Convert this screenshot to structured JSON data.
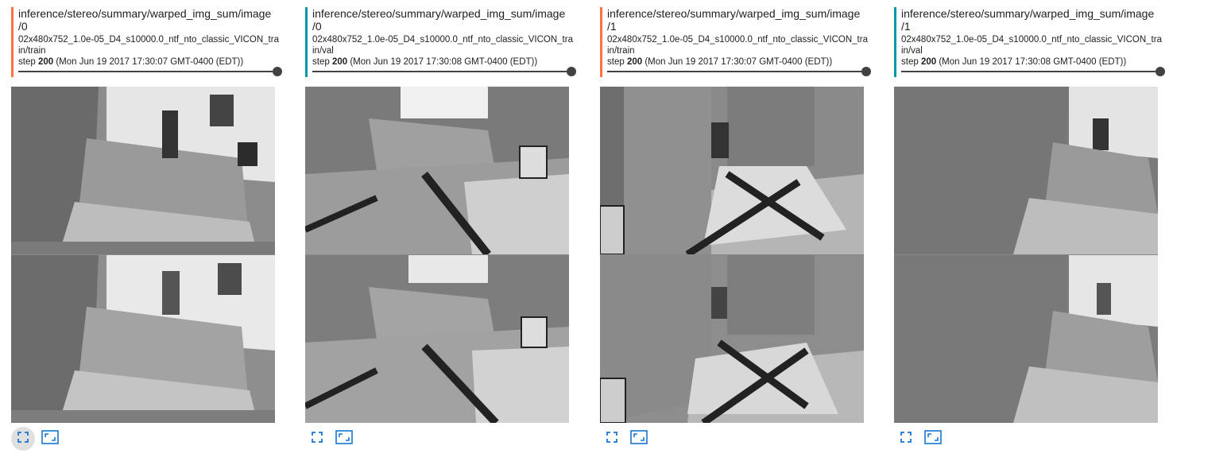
{
  "accent_colors": {
    "train": "#ff7043",
    "val": "#0097a7",
    "icon": "#1976d2"
  },
  "cards": [
    {
      "tag": "inference/stereo/summary/warped_img_sum/image/0",
      "run": "02x480x752_1.0e-05_D4_s10000.0_ntf_nto_classic_VICON_train/train",
      "step_prefix": "step",
      "step_value": "200",
      "timestamp": "(Mon Jun 19 2017 17:30:07 GMT-0400 (EDT))",
      "split": "train",
      "step_progress": 1.0,
      "actions": [
        "fit-to-screen-icon",
        "full-screen-icon"
      ]
    },
    {
      "tag": "inference/stereo/summary/warped_img_sum/image/0",
      "run": "02x480x752_1.0e-05_D4_s10000.0_ntf_nto_classic_VICON_train/val",
      "step_prefix": "step",
      "step_value": "200",
      "timestamp": "(Mon Jun 19 2017 17:30:08 GMT-0400 (EDT))",
      "split": "val",
      "step_progress": 1.0,
      "actions": [
        "fit-to-screen-icon",
        "full-screen-icon"
      ]
    },
    {
      "tag": "inference/stereo/summary/warped_img_sum/image/1",
      "run": "02x480x752_1.0e-05_D4_s10000.0_ntf_nto_classic_VICON_train/train",
      "step_prefix": "step",
      "step_value": "200",
      "timestamp": "(Mon Jun 19 2017 17:30:07 GMT-0400 (EDT))",
      "split": "train",
      "step_progress": 1.0,
      "actions": [
        "fit-to-screen-icon",
        "full-screen-icon"
      ]
    },
    {
      "tag": "inference/stereo/summary/warped_img_sum/image/1",
      "run": "02x480x752_1.0e-05_D4_s10000.0_ntf_nto_classic_VICON_train/val",
      "step_prefix": "step",
      "step_value": "200",
      "timestamp": "(Mon Jun 19 2017 17:30:08 GMT-0400 (EDT))",
      "split": "val",
      "step_progress": 1.0,
      "actions": [
        "fit-to-screen-icon",
        "full-screen-icon"
      ]
    }
  ]
}
